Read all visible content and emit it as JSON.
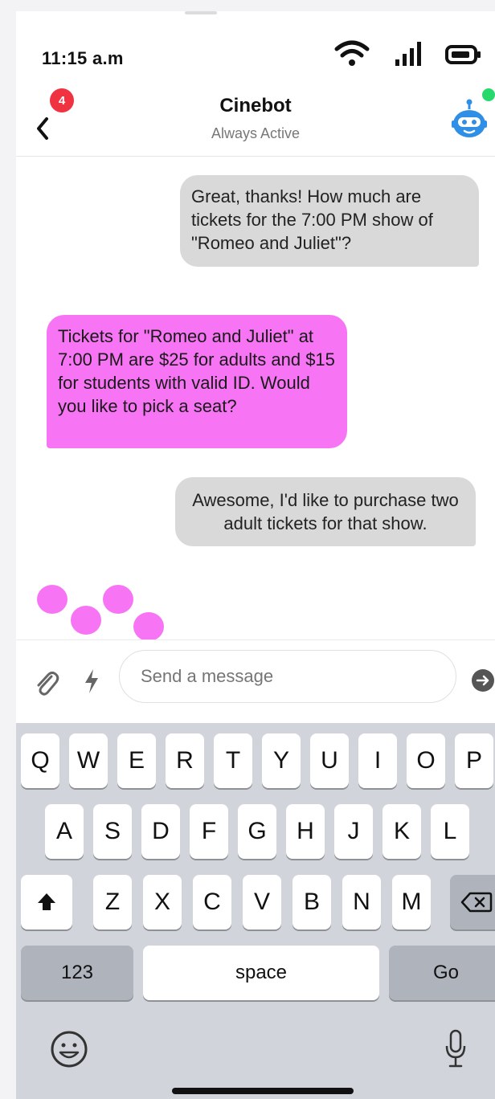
{
  "status": {
    "time": "11:15 a.m"
  },
  "header": {
    "badge_count": "4",
    "title": "Cinebot",
    "subtitle": "Always Active"
  },
  "messages": [
    {
      "from": "user",
      "text": "Great, thanks! How much are tickets for the 7:00 PM show of \"Romeo and Juliet\"?"
    },
    {
      "from": "bot",
      "text": "Tickets for \"Romeo and Juliet\" at 7:00 PM are $25 for adults and $15 for students with valid ID. Would you like to pick a seat?"
    },
    {
      "from": "user",
      "text": "Awesome, I'd like to purchase two adult tickets for that show."
    }
  ],
  "composer": {
    "placeholder": "Send a message"
  },
  "keyboard": {
    "row1": [
      "Q",
      "W",
      "E",
      "R",
      "T",
      "Y",
      "U",
      "I",
      "O",
      "P"
    ],
    "row2": [
      "A",
      "S",
      "D",
      "F",
      "G",
      "H",
      "J",
      "K",
      "L"
    ],
    "row3": [
      "Z",
      "X",
      "C",
      "V",
      "B",
      "N",
      "M"
    ],
    "numbers_label": "123",
    "space_label": "space",
    "go_label": "Go"
  },
  "colors": {
    "bot_bubble": "#f774f4",
    "user_bubble": "#d9d9d9",
    "badge": "#ef3340",
    "online": "#27d96b",
    "accent": "#2f8fe6"
  },
  "icons": [
    "chevron-left-icon",
    "robot-icon",
    "paperclip-icon",
    "lightning-icon",
    "send-arrow-icon",
    "shift-icon",
    "backspace-icon",
    "emoji-icon",
    "microphone-icon",
    "wifi-icon",
    "signal-icon",
    "battery-icon"
  ]
}
